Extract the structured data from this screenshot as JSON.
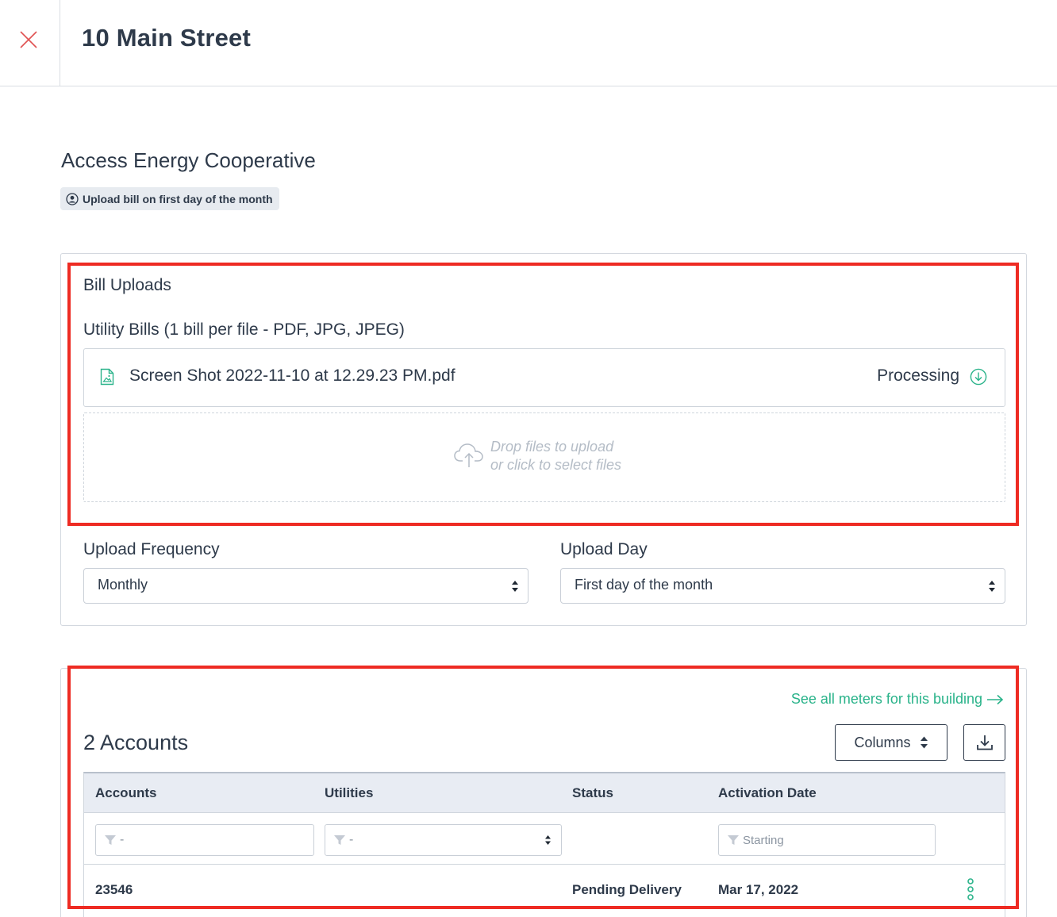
{
  "header": {
    "title": "10 Main Street"
  },
  "provider": {
    "name": "Access Energy Cooperative",
    "badge_label": "Upload bill on first day of the month"
  },
  "bill_uploads": {
    "title": "Bill Uploads",
    "utility_label": "Utility Bills (1 bill per file - PDF, JPG, JPEG)",
    "file": {
      "name": "Screen Shot 2022-11-10 at 12.29.23 PM.pdf",
      "status": "Processing"
    },
    "dropzone": {
      "line1": "Drop files to upload",
      "line2": "or click to select files"
    },
    "frequency": {
      "label": "Upload Frequency",
      "value": "Monthly"
    },
    "day": {
      "label": "Upload Day",
      "value": "First day of the month"
    }
  },
  "accounts": {
    "see_all_link": "See all meters for this building",
    "title": "2 Accounts",
    "columns_button": "Columns",
    "headers": [
      "Accounts",
      "Utilities",
      "Status",
      "Activation Date"
    ],
    "filters": {
      "accounts": "-",
      "utilities": "-",
      "activation_date": "Starting"
    },
    "rows": [
      {
        "account": "23546",
        "utility": "",
        "status": "Pending Delivery",
        "activation_date": "Mar 17, 2022"
      }
    ]
  },
  "colors": {
    "accent_green": "#2ab38a",
    "close_red": "#e05252",
    "highlight_red": "#ee2b23",
    "text": "#2e3a4a"
  }
}
